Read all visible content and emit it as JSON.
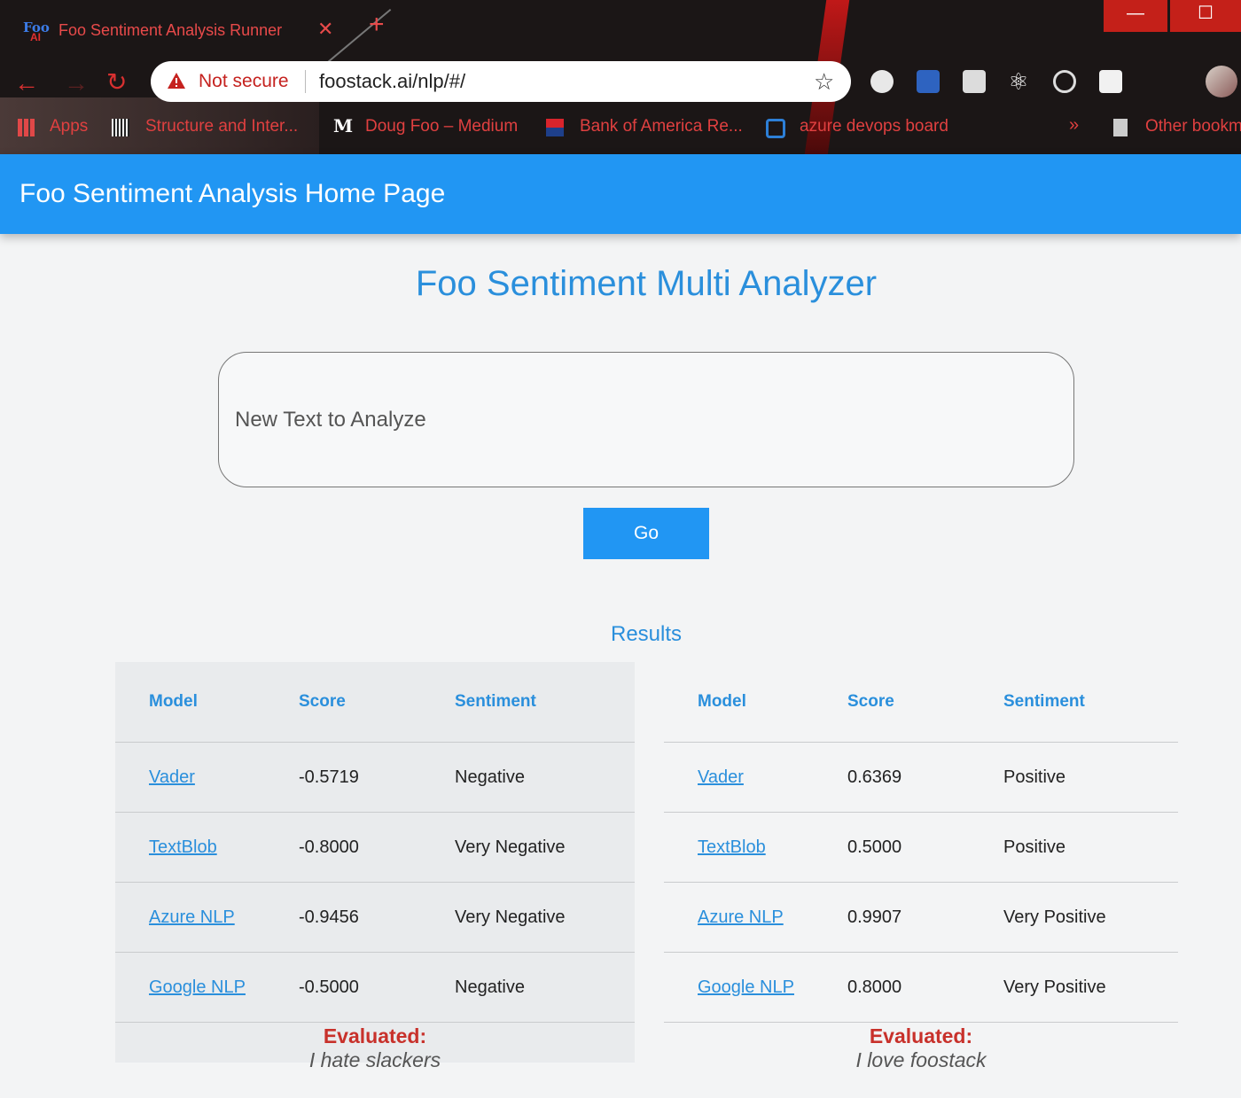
{
  "browser": {
    "tab_title": "Foo Sentiment Analysis Runner",
    "favicon_text_top": "Foo",
    "favicon_text_bottom": "AI",
    "security_label": "Not secure",
    "url": "foostack.ai/nlp/#/",
    "bookmarks": {
      "apps": "Apps",
      "structure": "Structure and Inter...",
      "medium_icon_text": "M",
      "medium": "Doug Foo – Medium",
      "boa": "Bank of America Re...",
      "azure": "azure devops board",
      "more": "»",
      "other": "Other bookm"
    }
  },
  "app": {
    "header_title": "Foo Sentiment Analysis Home Page",
    "page_heading": "Foo Sentiment Multi Analyzer",
    "input_placeholder": "New Text to Analyze",
    "go_label": "Go",
    "results_heading": "Results"
  },
  "results": [
    {
      "headers": [
        "Model",
        "Score",
        "Sentiment"
      ],
      "rows": [
        {
          "model": "Vader",
          "score": "-0.5719",
          "sentiment": "Negative"
        },
        {
          "model": "TextBlob",
          "score": "-0.8000",
          "sentiment": "Very Negative"
        },
        {
          "model": "Azure NLP",
          "score": "-0.9456",
          "sentiment": "Very Negative"
        },
        {
          "model": "Google NLP",
          "score": "-0.5000",
          "sentiment": "Negative"
        }
      ],
      "evaluated_label": "Evaluated:",
      "evaluated_text": "I hate slackers"
    },
    {
      "headers": [
        "Model",
        "Score",
        "Sentiment"
      ],
      "rows": [
        {
          "model": "Vader",
          "score": "0.6369",
          "sentiment": "Positive"
        },
        {
          "model": "TextBlob",
          "score": "0.5000",
          "sentiment": "Positive"
        },
        {
          "model": "Azure NLP",
          "score": "0.9907",
          "sentiment": "Very Positive"
        },
        {
          "model": "Google NLP",
          "score": "0.8000",
          "sentiment": "Very Positive"
        }
      ],
      "evaluated_label": "Evaluated:",
      "evaluated_text": "I love foostack"
    }
  ],
  "colors": {
    "primary": "#2196f3",
    "heading": "#2a8fdc",
    "evaluated_label": "#c8312b",
    "browser_accent": "#e04040"
  }
}
